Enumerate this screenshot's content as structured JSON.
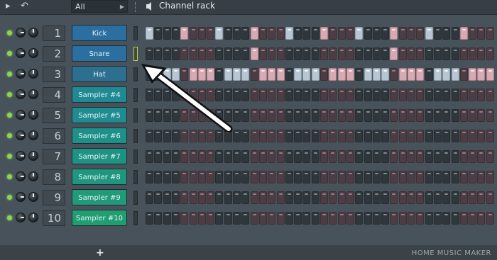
{
  "window": {
    "title": "Channel rack",
    "filter": "All"
  },
  "toolbar": {
    "add_label": "+"
  },
  "watermark": "HOME MUSIC MAKER",
  "colors": {
    "step_off": "#2f373c",
    "step_off_alt": "#4c3d44",
    "step_on": "#b7c6d2",
    "step_on_alt": "#d7a9b3",
    "led": "#8bd64f",
    "selector_active": "#b8d24d"
  },
  "channels": [
    {
      "number": "1",
      "name": "Kick",
      "color": "#2b6fa0",
      "steps": "1000100010001000100010001000100010001000"
    },
    {
      "number": "2",
      "name": "Snare",
      "color": "#2b6fa0",
      "steps": "0000000000001000000000000000100000000000"
    },
    {
      "number": "3",
      "name": "Hat",
      "color": "#2c6f8f",
      "steps": "0011011101110111011101110111011101110111"
    },
    {
      "number": "4",
      "name": "Sampler #4",
      "color": "#1f8a93",
      "steps": "0000000000000000000000000000000000000000"
    },
    {
      "number": "5",
      "name": "Sampler #5",
      "color": "#1f8c90",
      "steps": "0000000000000000000000000000000000000000"
    },
    {
      "number": "6",
      "name": "Sampler #6",
      "color": "#1e908a",
      "steps": "0000000000000000000000000000000000000000"
    },
    {
      "number": "7",
      "name": "Sampler #7",
      "color": "#1e9384",
      "steps": "0000000000000000000000000000000000000000"
    },
    {
      "number": "8",
      "name": "Sampler #8",
      "color": "#1f977e",
      "steps": "0000000000000000000000000000000000000000"
    },
    {
      "number": "9",
      "name": "Sampler #9",
      "color": "#209a78",
      "steps": "0000000000000000000000000000000000000000"
    },
    {
      "number": "10",
      "name": "Sampler #10",
      "color": "#219d72",
      "steps": "0000000000000000000000000000000000000000"
    }
  ]
}
